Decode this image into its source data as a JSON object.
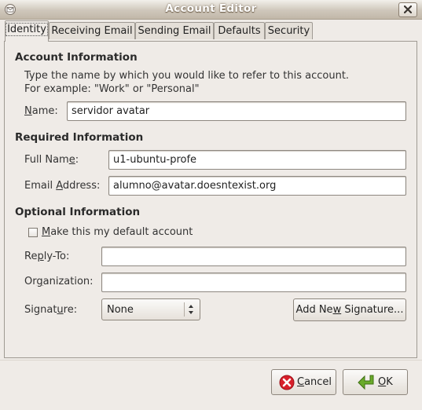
{
  "window": {
    "title": "Account Editor"
  },
  "tabs": [
    {
      "label": "Identity",
      "active": true
    },
    {
      "label": "Receiving Email",
      "active": false
    },
    {
      "label": "Sending Email",
      "active": false
    },
    {
      "label": "Defaults",
      "active": false
    },
    {
      "label": "Security",
      "active": false
    }
  ],
  "account_info": {
    "heading": "Account Information",
    "description_line1": "Type the name by which you would like to refer to this account.",
    "description_line2": "For example: \"Work\" or \"Personal\"",
    "name_label_mnemonic": "N",
    "name_label_rest": "ame:",
    "name_value": "servidor avatar"
  },
  "required_info": {
    "heading": "Required Information",
    "full_name_label_before": "Full Nam",
    "full_name_label_mnemonic": "e",
    "full_name_label_after": ":",
    "full_name_value": "u1-ubuntu-profe",
    "email_label_before": "Email ",
    "email_label_mnemonic": "A",
    "email_label_after": "ddress:",
    "email_value": "alumno@avatar.doesntexist.org"
  },
  "optional_info": {
    "heading": "Optional Information",
    "default_checkbox_mnemonic": "M",
    "default_checkbox_rest": "ake this my default account",
    "default_checked": false,
    "reply_to_label_before": "Re",
    "reply_to_label_mnemonic": "p",
    "reply_to_label_after": "ly-To:",
    "reply_to_value": "",
    "organization_label_before": "Or",
    "organization_label_mnemonic": "g",
    "organization_label_after": "anization:",
    "organization_value": "",
    "signature_label_before": "Signat",
    "signature_label_mnemonic": "u",
    "signature_label_after": "re:",
    "signature_value": "None",
    "add_signature_before": "Add Ne",
    "add_signature_mnemonic": "w",
    "add_signature_after": " Signature..."
  },
  "buttons": {
    "cancel_mnemonic": "C",
    "cancel_rest": "ancel",
    "ok_mnemonic": "O",
    "ok_rest": "K"
  },
  "colors": {
    "window_bg": "#efebe7",
    "cancel_icon": "#d8202b",
    "ok_icon": "#5c9a22"
  }
}
